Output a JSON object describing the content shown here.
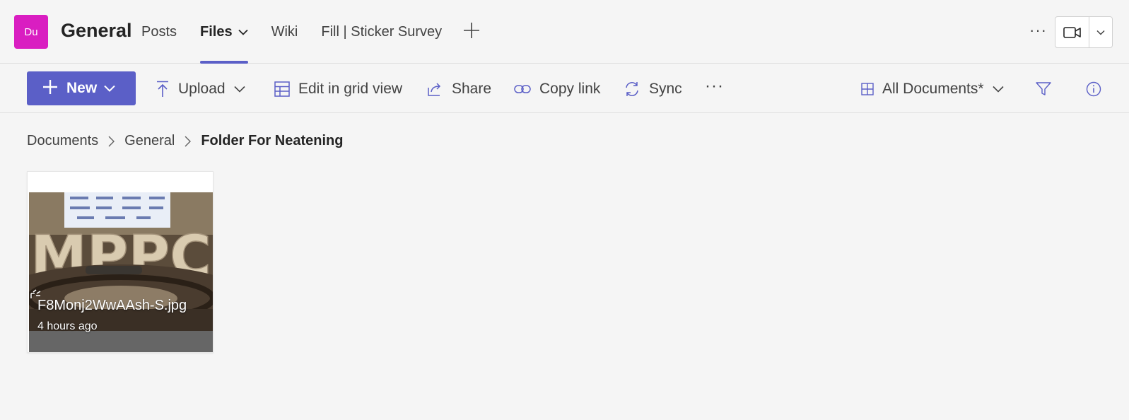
{
  "header": {
    "avatar_initials": "Du",
    "avatar_color": "#d91ec1",
    "channel_title": "General",
    "tabs": [
      {
        "label": "Posts"
      },
      {
        "label": "Files"
      },
      {
        "label": "Wiki"
      },
      {
        "label": "Fill | Sticker Survey"
      }
    ],
    "active_tab": "Files",
    "more_label": "···",
    "meet_icon": "video-camera-icon"
  },
  "toolbar": {
    "new_label": "New",
    "upload_label": "Upload",
    "grid_label": "Edit in grid view",
    "share_label": "Share",
    "copy_link_label": "Copy link",
    "sync_label": "Sync",
    "more_label": "···",
    "view_label": "All Documents*",
    "accent_color": "#5b5fc7"
  },
  "breadcrumb": {
    "items": [
      "Documents",
      "General",
      "Folder For Neatening"
    ]
  },
  "files": [
    {
      "name": "F8Monj2WwAAsh-S.jpg",
      "modified": "4 hours ago",
      "sign_text": "MPPC"
    }
  ]
}
